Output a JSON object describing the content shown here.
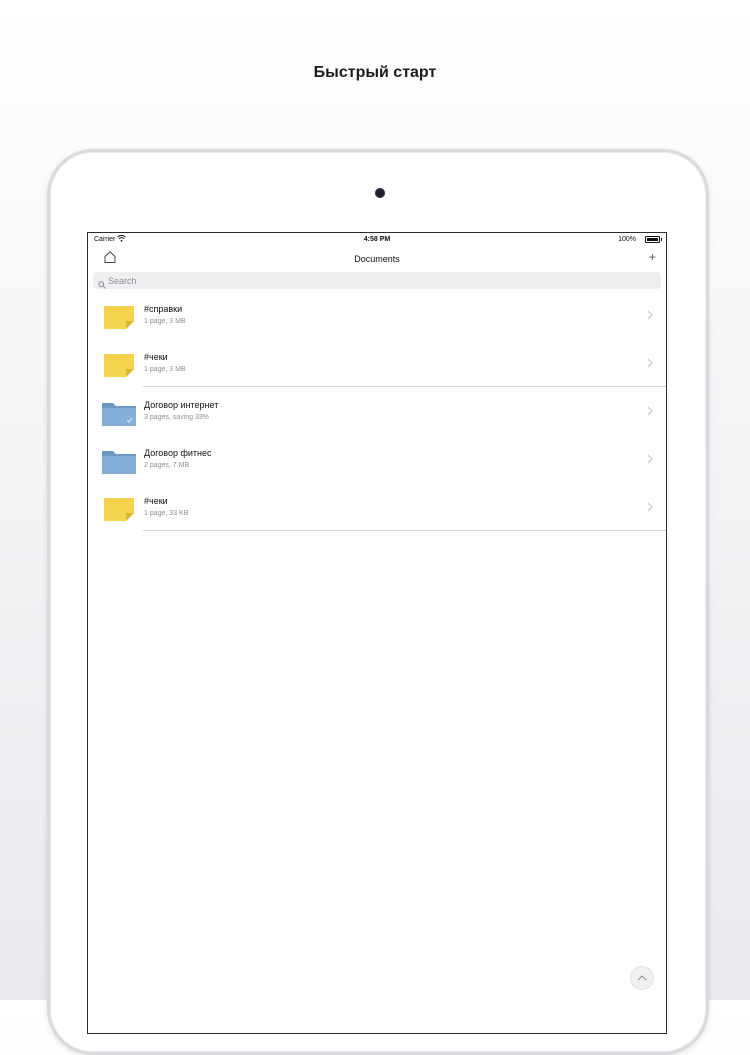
{
  "headline": "Быстрый старт",
  "status_bar": {
    "carrier": "Carrier",
    "time": "4:58 PM",
    "battery": "100%"
  },
  "navbar": {
    "title": "Documents",
    "add_label": "+"
  },
  "search": {
    "placeholder": "Search"
  },
  "colors": {
    "sticky_note": "#f5d34d",
    "folder": "#7fa7d3",
    "separator": "#d6d6da"
  },
  "items": [
    {
      "title": "#справки",
      "subtitle": "1 page, 3 MB",
      "icon": "sticky-note-icon"
    },
    {
      "title": "#чеки",
      "subtitle": "1 page, 3 MB",
      "icon": "sticky-note-icon"
    },
    {
      "title": "Договор интернет",
      "subtitle": "3 pages,  saving 33%",
      "icon": "folder-icon"
    },
    {
      "title": "Договор фитнес",
      "subtitle": "2 pages, 7 MB",
      "icon": "folder-icon"
    },
    {
      "title": "#чеки",
      "subtitle": "1 page, 33 KB",
      "icon": "sticky-note-icon"
    }
  ]
}
